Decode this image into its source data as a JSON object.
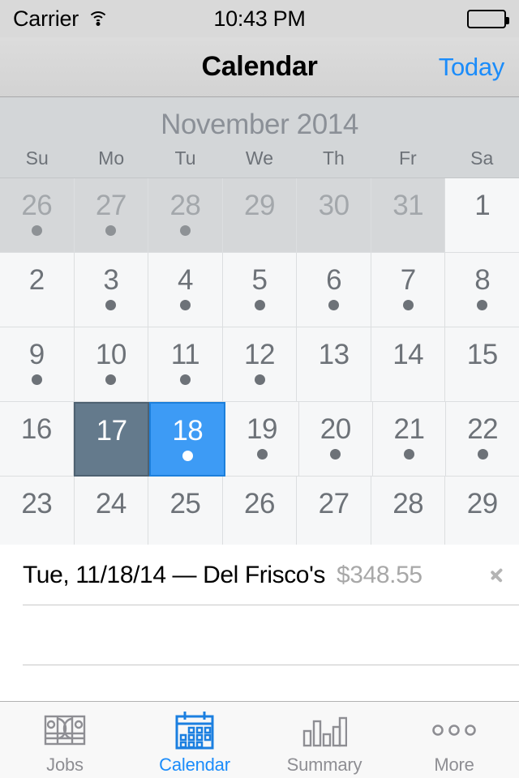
{
  "status_bar": {
    "carrier": "Carrier",
    "wifi_icon": "wifi-icon",
    "time": "10:43 PM",
    "battery_icon": "battery-full-icon"
  },
  "nav_bar": {
    "title": "Calendar",
    "right_button": "Today"
  },
  "calendar": {
    "month_title": "November 2014",
    "weekdays": [
      "Su",
      "Mo",
      "Tu",
      "We",
      "Th",
      "Fr",
      "Sa"
    ],
    "accent_selected": "#3d9bf5",
    "accent_today": "#647a8c",
    "weeks": [
      [
        {
          "day": "26",
          "other_month": true,
          "dot": true,
          "today": false,
          "selected": false
        },
        {
          "day": "27",
          "other_month": true,
          "dot": true,
          "today": false,
          "selected": false
        },
        {
          "day": "28",
          "other_month": true,
          "dot": true,
          "today": false,
          "selected": false
        },
        {
          "day": "29",
          "other_month": true,
          "dot": false,
          "today": false,
          "selected": false
        },
        {
          "day": "30",
          "other_month": true,
          "dot": false,
          "today": false,
          "selected": false
        },
        {
          "day": "31",
          "other_month": true,
          "dot": false,
          "today": false,
          "selected": false
        },
        {
          "day": "1",
          "other_month": false,
          "dot": false,
          "today": false,
          "selected": false
        }
      ],
      [
        {
          "day": "2",
          "other_month": false,
          "dot": false,
          "today": false,
          "selected": false
        },
        {
          "day": "3",
          "other_month": false,
          "dot": true,
          "today": false,
          "selected": false
        },
        {
          "day": "4",
          "other_month": false,
          "dot": true,
          "today": false,
          "selected": false
        },
        {
          "day": "5",
          "other_month": false,
          "dot": true,
          "today": false,
          "selected": false
        },
        {
          "day": "6",
          "other_month": false,
          "dot": true,
          "today": false,
          "selected": false
        },
        {
          "day": "7",
          "other_month": false,
          "dot": true,
          "today": false,
          "selected": false
        },
        {
          "day": "8",
          "other_month": false,
          "dot": true,
          "today": false,
          "selected": false
        }
      ],
      [
        {
          "day": "9",
          "other_month": false,
          "dot": true,
          "today": false,
          "selected": false
        },
        {
          "day": "10",
          "other_month": false,
          "dot": true,
          "today": false,
          "selected": false
        },
        {
          "day": "11",
          "other_month": false,
          "dot": true,
          "today": false,
          "selected": false
        },
        {
          "day": "12",
          "other_month": false,
          "dot": true,
          "today": false,
          "selected": false
        },
        {
          "day": "13",
          "other_month": false,
          "dot": false,
          "today": false,
          "selected": false
        },
        {
          "day": "14",
          "other_month": false,
          "dot": false,
          "today": false,
          "selected": false
        },
        {
          "day": "15",
          "other_month": false,
          "dot": false,
          "today": false,
          "selected": false
        }
      ],
      [
        {
          "day": "16",
          "other_month": false,
          "dot": false,
          "today": false,
          "selected": false
        },
        {
          "day": "17",
          "other_month": false,
          "dot": false,
          "today": true,
          "selected": false
        },
        {
          "day": "18",
          "other_month": false,
          "dot": true,
          "today": false,
          "selected": true
        },
        {
          "day": "19",
          "other_month": false,
          "dot": true,
          "today": false,
          "selected": false
        },
        {
          "day": "20",
          "other_month": false,
          "dot": true,
          "today": false,
          "selected": false
        },
        {
          "day": "21",
          "other_month": false,
          "dot": true,
          "today": false,
          "selected": false
        },
        {
          "day": "22",
          "other_month": false,
          "dot": true,
          "today": false,
          "selected": false
        }
      ],
      [
        {
          "day": "23",
          "other_month": false,
          "dot": false,
          "today": false,
          "selected": false
        },
        {
          "day": "24",
          "other_month": false,
          "dot": false,
          "today": false,
          "selected": false
        },
        {
          "day": "25",
          "other_month": false,
          "dot": false,
          "today": false,
          "selected": false
        },
        {
          "day": "26",
          "other_month": false,
          "dot": false,
          "today": false,
          "selected": false
        },
        {
          "day": "27",
          "other_month": false,
          "dot": false,
          "today": false,
          "selected": false
        },
        {
          "day": "28",
          "other_month": false,
          "dot": false,
          "today": false,
          "selected": false
        },
        {
          "day": "29",
          "other_month": false,
          "dot": false,
          "today": false,
          "selected": false
        }
      ]
    ]
  },
  "event_list": {
    "events": [
      {
        "title": "Tue, 11/18/14 — Del Frisco's",
        "amount": "$348.55"
      }
    ]
  },
  "tab_bar": {
    "items": [
      {
        "label": "Jobs",
        "icon": "money-icon",
        "active": false
      },
      {
        "label": "Calendar",
        "icon": "calendar-icon",
        "active": true
      },
      {
        "label": "Summary",
        "icon": "bar-chart-icon",
        "active": false
      },
      {
        "label": "More",
        "icon": "ellipsis-icon",
        "active": false
      }
    ]
  }
}
